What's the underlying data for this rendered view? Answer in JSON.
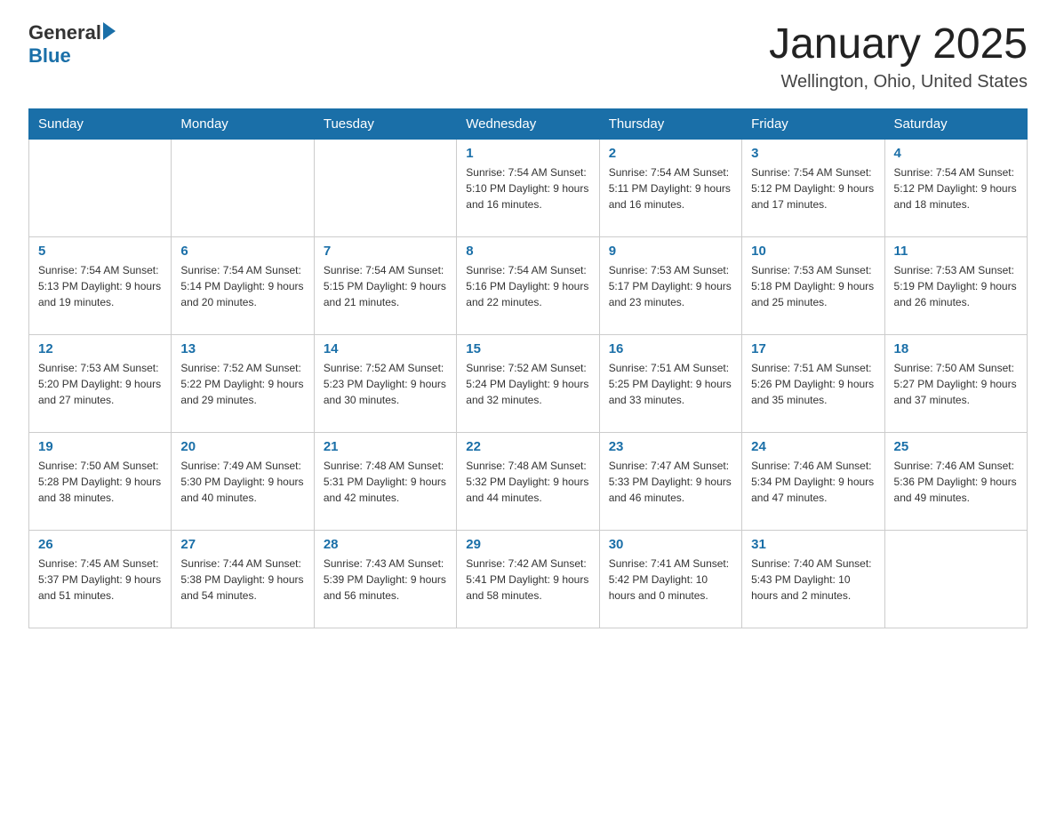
{
  "header": {
    "logo_general": "General",
    "logo_blue": "Blue",
    "month_title": "January 2025",
    "location": "Wellington, Ohio, United States"
  },
  "weekdays": [
    "Sunday",
    "Monday",
    "Tuesday",
    "Wednesday",
    "Thursday",
    "Friday",
    "Saturday"
  ],
  "weeks": [
    [
      {
        "day": "",
        "info": ""
      },
      {
        "day": "",
        "info": ""
      },
      {
        "day": "",
        "info": ""
      },
      {
        "day": "1",
        "info": "Sunrise: 7:54 AM\nSunset: 5:10 PM\nDaylight: 9 hours\nand 16 minutes."
      },
      {
        "day": "2",
        "info": "Sunrise: 7:54 AM\nSunset: 5:11 PM\nDaylight: 9 hours\nand 16 minutes."
      },
      {
        "day": "3",
        "info": "Sunrise: 7:54 AM\nSunset: 5:12 PM\nDaylight: 9 hours\nand 17 minutes."
      },
      {
        "day": "4",
        "info": "Sunrise: 7:54 AM\nSunset: 5:12 PM\nDaylight: 9 hours\nand 18 minutes."
      }
    ],
    [
      {
        "day": "5",
        "info": "Sunrise: 7:54 AM\nSunset: 5:13 PM\nDaylight: 9 hours\nand 19 minutes."
      },
      {
        "day": "6",
        "info": "Sunrise: 7:54 AM\nSunset: 5:14 PM\nDaylight: 9 hours\nand 20 minutes."
      },
      {
        "day": "7",
        "info": "Sunrise: 7:54 AM\nSunset: 5:15 PM\nDaylight: 9 hours\nand 21 minutes."
      },
      {
        "day": "8",
        "info": "Sunrise: 7:54 AM\nSunset: 5:16 PM\nDaylight: 9 hours\nand 22 minutes."
      },
      {
        "day": "9",
        "info": "Sunrise: 7:53 AM\nSunset: 5:17 PM\nDaylight: 9 hours\nand 23 minutes."
      },
      {
        "day": "10",
        "info": "Sunrise: 7:53 AM\nSunset: 5:18 PM\nDaylight: 9 hours\nand 25 minutes."
      },
      {
        "day": "11",
        "info": "Sunrise: 7:53 AM\nSunset: 5:19 PM\nDaylight: 9 hours\nand 26 minutes."
      }
    ],
    [
      {
        "day": "12",
        "info": "Sunrise: 7:53 AM\nSunset: 5:20 PM\nDaylight: 9 hours\nand 27 minutes."
      },
      {
        "day": "13",
        "info": "Sunrise: 7:52 AM\nSunset: 5:22 PM\nDaylight: 9 hours\nand 29 minutes."
      },
      {
        "day": "14",
        "info": "Sunrise: 7:52 AM\nSunset: 5:23 PM\nDaylight: 9 hours\nand 30 minutes."
      },
      {
        "day": "15",
        "info": "Sunrise: 7:52 AM\nSunset: 5:24 PM\nDaylight: 9 hours\nand 32 minutes."
      },
      {
        "day": "16",
        "info": "Sunrise: 7:51 AM\nSunset: 5:25 PM\nDaylight: 9 hours\nand 33 minutes."
      },
      {
        "day": "17",
        "info": "Sunrise: 7:51 AM\nSunset: 5:26 PM\nDaylight: 9 hours\nand 35 minutes."
      },
      {
        "day": "18",
        "info": "Sunrise: 7:50 AM\nSunset: 5:27 PM\nDaylight: 9 hours\nand 37 minutes."
      }
    ],
    [
      {
        "day": "19",
        "info": "Sunrise: 7:50 AM\nSunset: 5:28 PM\nDaylight: 9 hours\nand 38 minutes."
      },
      {
        "day": "20",
        "info": "Sunrise: 7:49 AM\nSunset: 5:30 PM\nDaylight: 9 hours\nand 40 minutes."
      },
      {
        "day": "21",
        "info": "Sunrise: 7:48 AM\nSunset: 5:31 PM\nDaylight: 9 hours\nand 42 minutes."
      },
      {
        "day": "22",
        "info": "Sunrise: 7:48 AM\nSunset: 5:32 PM\nDaylight: 9 hours\nand 44 minutes."
      },
      {
        "day": "23",
        "info": "Sunrise: 7:47 AM\nSunset: 5:33 PM\nDaylight: 9 hours\nand 46 minutes."
      },
      {
        "day": "24",
        "info": "Sunrise: 7:46 AM\nSunset: 5:34 PM\nDaylight: 9 hours\nand 47 minutes."
      },
      {
        "day": "25",
        "info": "Sunrise: 7:46 AM\nSunset: 5:36 PM\nDaylight: 9 hours\nand 49 minutes."
      }
    ],
    [
      {
        "day": "26",
        "info": "Sunrise: 7:45 AM\nSunset: 5:37 PM\nDaylight: 9 hours\nand 51 minutes."
      },
      {
        "day": "27",
        "info": "Sunrise: 7:44 AM\nSunset: 5:38 PM\nDaylight: 9 hours\nand 54 minutes."
      },
      {
        "day": "28",
        "info": "Sunrise: 7:43 AM\nSunset: 5:39 PM\nDaylight: 9 hours\nand 56 minutes."
      },
      {
        "day": "29",
        "info": "Sunrise: 7:42 AM\nSunset: 5:41 PM\nDaylight: 9 hours\nand 58 minutes."
      },
      {
        "day": "30",
        "info": "Sunrise: 7:41 AM\nSunset: 5:42 PM\nDaylight: 10 hours\nand 0 minutes."
      },
      {
        "day": "31",
        "info": "Sunrise: 7:40 AM\nSunset: 5:43 PM\nDaylight: 10 hours\nand 2 minutes."
      },
      {
        "day": "",
        "info": ""
      }
    ]
  ]
}
